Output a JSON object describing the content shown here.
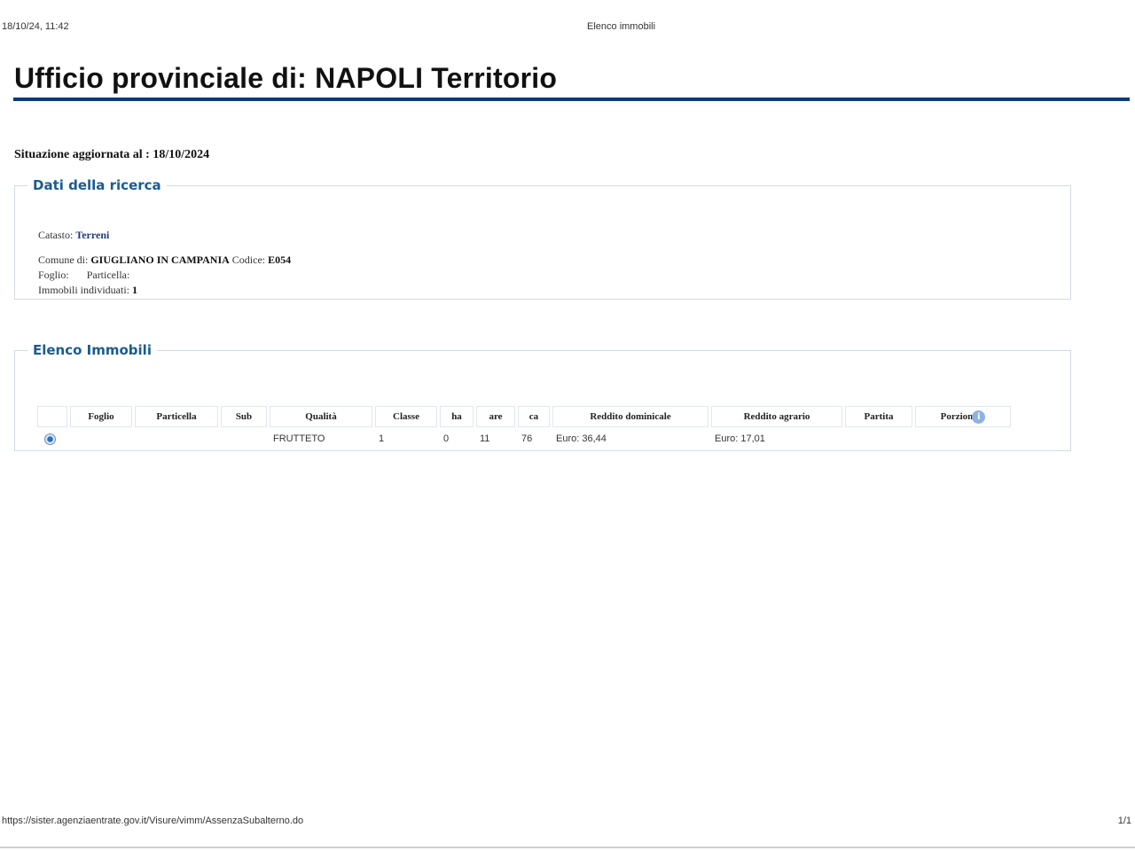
{
  "print_header": {
    "datetime": "18/10/24, 11:42",
    "doc_title": "Elenco immobili"
  },
  "page": {
    "title": "Ufficio provinciale di: NAPOLI Territorio",
    "situazione": "Situazione aggiornata al : 18/10/2024"
  },
  "ricerca": {
    "legend": "Dati della ricerca",
    "catasto_label": "Catasto:",
    "catasto_value": "Terreni",
    "comune_label": "Comune di:",
    "comune_value": "GIUGLIANO IN CAMPANIA",
    "codice_label": "Codice:",
    "codice_value": "E054",
    "foglio_label": "Foglio:",
    "particella_label": "Particella:",
    "immobili_label": "Immobili individuati:",
    "immobili_value": "1"
  },
  "elenco": {
    "legend": "Elenco Immobili",
    "columns": [
      "",
      "Foglio",
      "Particella",
      "Sub",
      "Qualità",
      "Classe",
      "ha",
      "are",
      "ca",
      "Reddito dominicale",
      "Reddito agrario",
      "Partita",
      "Porzioni"
    ],
    "rows": [
      {
        "selected": true,
        "foglio": "",
        "particella": "",
        "sub": "",
        "qualita": "FRUTTETO",
        "classe": "1",
        "ha": "0",
        "are": "11",
        "ca": "76",
        "reddito_dominicale": "Euro: 36,44",
        "reddito_agrario": "Euro: 17,01",
        "partita": "",
        "porzioni": ""
      }
    ]
  },
  "print_footer": {
    "url": "https://sister.agenziaentrate.gov.it/Visure/vimm/AssenzaSubalterno.do",
    "page_num": "1/1"
  },
  "icons": {
    "radio": "radio-selected-icon",
    "info": "info-icon"
  },
  "colors": {
    "title_rule": "#0c3a78",
    "legend": "#1b5b8f",
    "link_value": "#1f3a7a"
  }
}
